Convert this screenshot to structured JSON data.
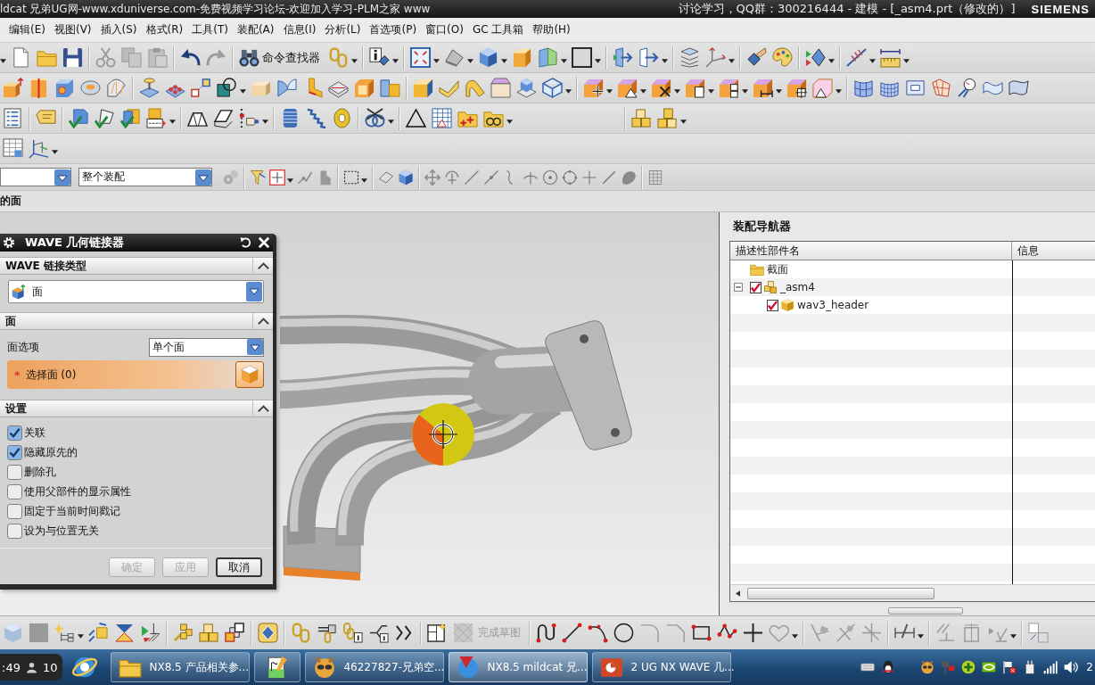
{
  "title_bar": {
    "title_left": "ldcat 兄弟UG网-www.xduniverse.com-免费视频学习论坛-欢迎加入学习-PLM之家 www",
    "title_right": "讨论学习，QQ群：300216444 - 建模 - [_asm4.prt（修改的）]",
    "logo": "SIEMENS"
  },
  "menu_bar": [
    "编辑(E)",
    "视图(V)",
    "插入(S)",
    "格式(R)",
    "工具(T)",
    "装配(A)",
    "信息(I)",
    "分析(L)",
    "首选项(P)",
    "窗口(O)",
    "GC 工具箱",
    "帮助(H)"
  ],
  "toolbar": {
    "command_finder": "命令查找器"
  },
  "selection_bar": {
    "scope": "整个装配"
  },
  "status_line": "的面",
  "dialog": {
    "title": "WAVE 几何链接器",
    "link_type": {
      "header": "WAVE 链接类型",
      "expanded": true,
      "value": "面"
    },
    "face": {
      "header": "面",
      "expanded": true,
      "option_label": "面选项",
      "option_value": "单个面",
      "selection": {
        "marker": "*",
        "label": "选择面 (0)",
        "selected": true
      }
    },
    "settings": {
      "header": "设置",
      "expanded": true,
      "options": [
        {
          "label": "关联",
          "checked": true
        },
        {
          "label": "隐藏原先的",
          "checked": true
        },
        {
          "label": "删除孔",
          "checked": false
        },
        {
          "label": "使用父部件的显示属性",
          "checked": false
        },
        {
          "label": "固定于当前时间戳记",
          "checked": false
        },
        {
          "label": "设为与位置无关",
          "checked": false
        }
      ]
    },
    "buttons": [
      {
        "label": "确定",
        "disabled": true
      },
      {
        "label": "应用",
        "disabled": true
      },
      {
        "label": "取消",
        "disabled": false
      }
    ]
  },
  "navigator": {
    "title": "装配导航器",
    "columns": [
      "描述性部件名",
      "信息"
    ],
    "tree": [
      {
        "label": "截面",
        "kind": "folder"
      },
      {
        "label": "_asm4",
        "kind": "assembly",
        "checked": true,
        "expanded": true,
        "children": [
          {
            "label": "wav3_header",
            "kind": "part",
            "checked": true
          }
        ]
      }
    ]
  },
  "bottom_toolbar": {
    "finish_sketch": {
      "label": "完成草图",
      "disabled": true
    }
  },
  "taskbar": {
    "widget": {
      "time": ":49",
      "count": "10"
    },
    "items": [
      {
        "kind": "window",
        "label": "NX8.5 产品相关参...",
        "selected": false
      },
      {
        "kind": "icon_only",
        "selected": false
      },
      {
        "kind": "window",
        "label": "46227827-兄弟空...",
        "selected": false
      },
      {
        "kind": "window",
        "label": "NX8.5 mildcat 兄...",
        "selected": true
      },
      {
        "kind": "window",
        "label": "2 UG NX WAVE 几...",
        "selected": false
      }
    ],
    "clock": "2"
  }
}
